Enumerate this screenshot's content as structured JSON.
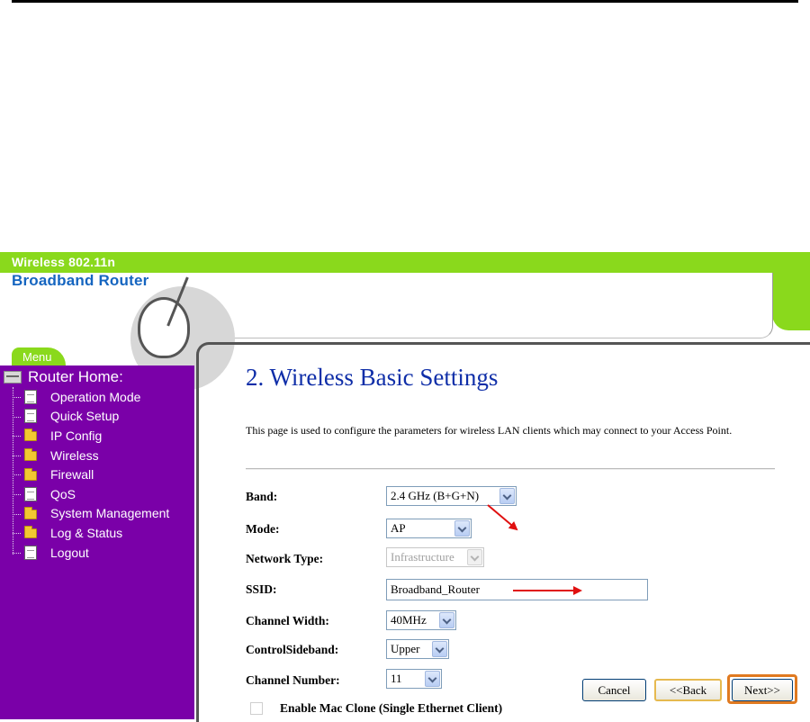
{
  "brand": {
    "line1": "Wireless 802.11n",
    "line2": "Broadband Router"
  },
  "colors": {
    "sidebar": "#7a00a8",
    "accent_green": "#8ad91c",
    "title_blue": "#0f2ea8",
    "annotation_red": "#e01010",
    "highlight_orange": "#e07a20"
  },
  "menu": {
    "tab_label": "Menu",
    "root_label": "Router Home:",
    "items": [
      {
        "label": "Operation Mode",
        "icon": "document-icon"
      },
      {
        "label": "Quick Setup",
        "icon": "document-icon"
      },
      {
        "label": "IP Config",
        "icon": "folder-icon"
      },
      {
        "label": "Wireless",
        "icon": "folder-icon"
      },
      {
        "label": "Firewall",
        "icon": "folder-icon"
      },
      {
        "label": "QoS",
        "icon": "document-icon"
      },
      {
        "label": "System Management",
        "icon": "folder-icon"
      },
      {
        "label": "Log & Status",
        "icon": "folder-icon"
      },
      {
        "label": "Logout",
        "icon": "document-icon"
      }
    ]
  },
  "page": {
    "title": "2. Wireless Basic Settings",
    "description": "This page is used to configure the parameters for wireless LAN clients which may connect to your Access Point."
  },
  "form": {
    "band": {
      "label": "Band:",
      "value": "2.4 GHz (B+G+N)"
    },
    "mode": {
      "label": "Mode:",
      "value": "AP"
    },
    "network_type": {
      "label": "Network Type:",
      "value": "Infrastructure"
    },
    "ssid": {
      "label": "SSID:",
      "value": "Broadband_Router"
    },
    "channel_width": {
      "label": "Channel Width:",
      "value": "40MHz"
    },
    "control_sideband": {
      "label": "ControlSideband:",
      "value": "Upper"
    },
    "channel_number": {
      "label": "Channel Number:",
      "value": "11"
    },
    "mac_clone": {
      "label": "Enable Mac Clone (Single Ethernet Client)",
      "checked": false
    }
  },
  "buttons": {
    "cancel": "Cancel",
    "back": "<<Back",
    "next": "Next>>"
  }
}
